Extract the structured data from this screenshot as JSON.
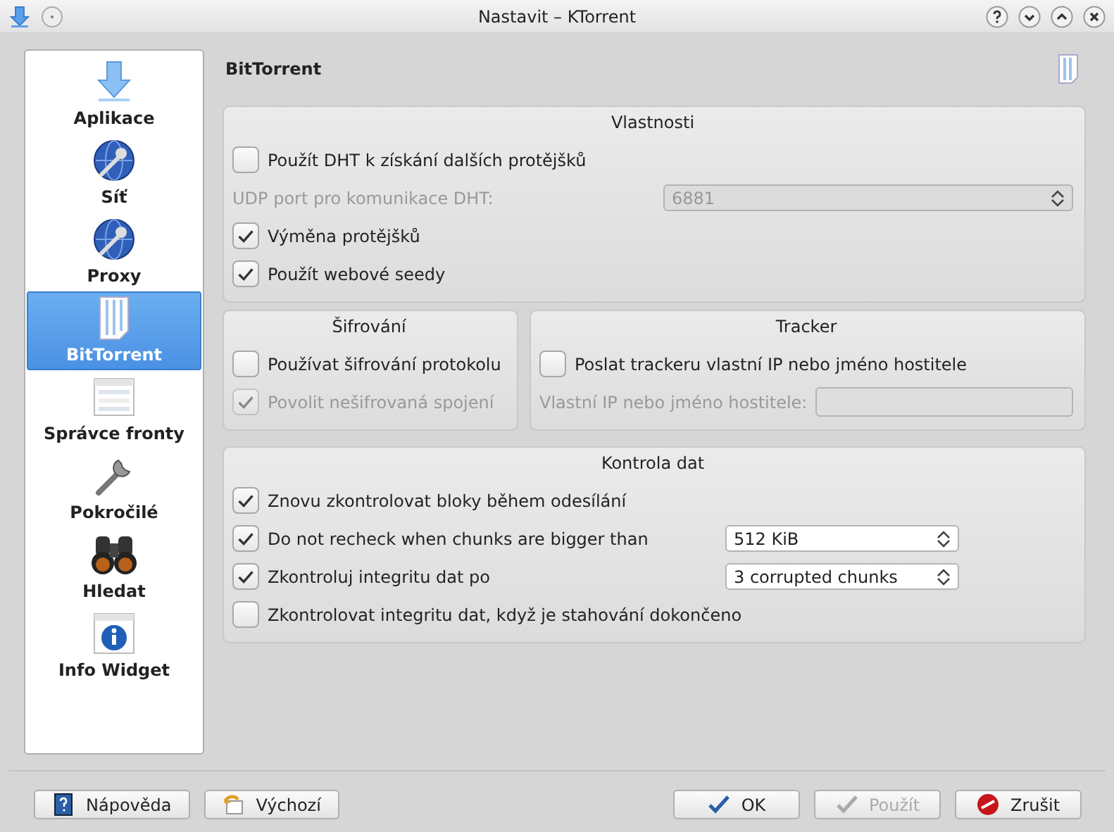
{
  "window": {
    "title": "Nastavit – KTorrent"
  },
  "sidebar": {
    "items": [
      {
        "label": "Aplikace",
        "selected": false
      },
      {
        "label": "Síť",
        "selected": false
      },
      {
        "label": "Proxy",
        "selected": false
      },
      {
        "label": "BitTorrent",
        "selected": true
      },
      {
        "label": "Správce fronty",
        "selected": false
      },
      {
        "label": "Pokročilé",
        "selected": false
      },
      {
        "label": "Hledat",
        "selected": false
      },
      {
        "label": "Info Widget",
        "selected": false
      }
    ]
  },
  "page": {
    "title": "BitTorrent"
  },
  "group_rows": [
    {
      "groups": [
        {
          "title": "Vlastnosti",
          "rows": [
            {
              "kind": "checkbox",
              "label": "Použít DHT k získání dalších protějšků",
              "checked": false,
              "disabled": false
            },
            {
              "kind": "spinbox",
              "label": "UDP port pro komunikace DHT:",
              "value": "6881",
              "disabled": true
            },
            {
              "kind": "checkbox",
              "label": "Výměna protějšků",
              "checked": true,
              "disabled": false
            },
            {
              "kind": "checkbox",
              "label": "Použít webové seedy",
              "checked": true,
              "disabled": false
            }
          ]
        }
      ]
    },
    {
      "groups": [
        {
          "title": "Šifrování",
          "rows": [
            {
              "kind": "checkbox",
              "label": "Používat šifrování protokolu",
              "checked": false,
              "disabled": false
            },
            {
              "kind": "checkbox",
              "label": "Povolit nešifrovaná spojení",
              "checked": true,
              "disabled": true
            }
          ]
        },
        {
          "title": "Tracker",
          "rows": [
            {
              "kind": "checkbox",
              "label": "Poslat trackeru vlastní IP nebo jméno hostitele",
              "checked": false,
              "disabled": false
            },
            {
              "kind": "field",
              "label": "Vlastní IP nebo jméno hostitele:",
              "disabled": true
            }
          ]
        }
      ]
    },
    {
      "groups": [
        {
          "title": "Kontrola dat",
          "rows": [
            {
              "kind": "checkbox",
              "label": "Znovu zkontrolovat bloky během odesílání",
              "checked": true,
              "disabled": false
            },
            {
              "kind": "checkcombo",
              "label": "Do not recheck when chunks are bigger than",
              "checked": true,
              "disabled": false,
              "value": "512 KiB"
            },
            {
              "kind": "checkcombo",
              "label": "Zkontroluj integritu dat po",
              "checked": true,
              "disabled": false,
              "value": "3 corrupted chunks"
            },
            {
              "kind": "checkbox",
              "label": "Zkontrolovat integritu dat, když je stahování dokončeno",
              "checked": false,
              "disabled": false
            }
          ]
        }
      ]
    }
  ],
  "buttons_left": [
    {
      "label": "Nápověda",
      "disabled": false
    },
    {
      "label": "Výchozí",
      "disabled": false
    }
  ],
  "buttons_right": [
    {
      "label": "OK",
      "disabled": false
    },
    {
      "label": "Použít",
      "disabled": true
    },
    {
      "label": "Zrušit",
      "disabled": false
    }
  ]
}
